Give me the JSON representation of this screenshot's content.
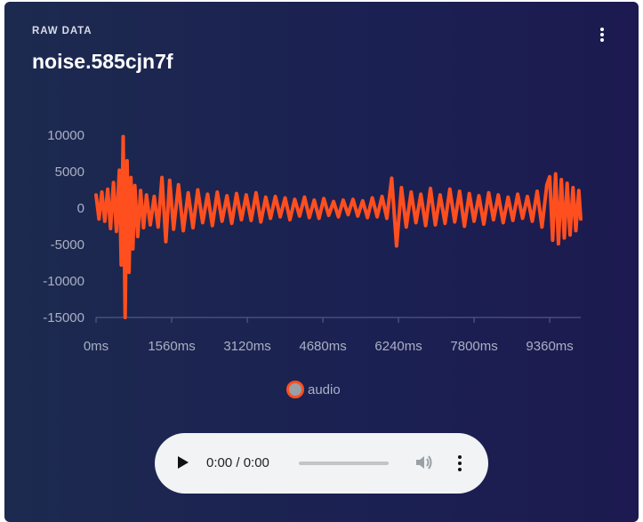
{
  "card": {
    "eyebrow": "RAW DATA",
    "title": "noise.585cjn7f"
  },
  "chart_data": {
    "type": "line",
    "title": "",
    "xlabel": "",
    "ylabel": "",
    "x_unit": "ms",
    "xlim": [
      0,
      10000
    ],
    "ylim": [
      -15000,
      10000
    ],
    "y_ticks": [
      "10000",
      "5000",
      "0",
      "-5000",
      "-10000",
      "-15000"
    ],
    "x_ticks": [
      "0ms",
      "1560ms",
      "3120ms",
      "4680ms",
      "6240ms",
      "7800ms",
      "9360ms"
    ],
    "legend_position": "bottom",
    "grid": false,
    "series": [
      {
        "name": "audio",
        "color": "#ff4f1f",
        "x": [
          0,
          60,
          120,
          180,
          240,
          300,
          360,
          420,
          480,
          520,
          560,
          600,
          640,
          680,
          720,
          760,
          800,
          860,
          920,
          980,
          1040,
          1120,
          1200,
          1280,
          1360,
          1440,
          1520,
          1600,
          1700,
          1800,
          1900,
          2000,
          2100,
          2200,
          2300,
          2400,
          2500,
          2600,
          2700,
          2800,
          2900,
          3000,
          3100,
          3200,
          3300,
          3400,
          3500,
          3600,
          3700,
          3800,
          3900,
          4000,
          4100,
          4200,
          4300,
          4400,
          4500,
          4600,
          4700,
          4800,
          4900,
          5000,
          5100,
          5200,
          5300,
          5400,
          5500,
          5600,
          5700,
          5800,
          5900,
          6000,
          6100,
          6200,
          6300,
          6400,
          6500,
          6600,
          6700,
          6800,
          6900,
          7000,
          7100,
          7200,
          7300,
          7400,
          7500,
          7600,
          7700,
          7800,
          7900,
          8000,
          8100,
          8200,
          8300,
          8400,
          8500,
          8600,
          8700,
          8800,
          8900,
          9000,
          9100,
          9200,
          9300,
          9360,
          9420,
          9480,
          9540,
          9600,
          9660,
          9720,
          9780,
          9840,
          9900,
          9960,
          10000
        ],
        "values": [
          1800,
          -1500,
          2200,
          -1800,
          2600,
          -2800,
          3500,
          -3200,
          5200,
          -7800,
          9800,
          -15000,
          6500,
          -8800,
          4200,
          -5600,
          3100,
          -3900,
          2400,
          -2700,
          1800,
          -2300,
          1600,
          -2600,
          4200,
          -4600,
          3800,
          -2900,
          3200,
          -3100,
          2100,
          -2700,
          2500,
          -2000,
          1900,
          -2400,
          2200,
          -1800,
          1700,
          -2100,
          2000,
          -1600,
          1800,
          -1700,
          2100,
          -1900,
          1500,
          -1400,
          1600,
          -1200,
          1400,
          -1600,
          1200,
          -1100,
          1500,
          -1300,
          1100,
          -1400,
          1300,
          -1000,
          900,
          -1200,
          1100,
          -900,
          1200,
          -1100,
          1000,
          -1300,
          1400,
          -1200,
          1600,
          -1400,
          4100,
          -5200,
          2800,
          -2600,
          2200,
          -2000,
          1900,
          -2400,
          2700,
          -2300,
          1800,
          -2100,
          2600,
          -1900,
          2300,
          -2500,
          2000,
          -1800,
          1700,
          -2200,
          2100,
          -1600,
          1800,
          -2000,
          1500,
          -1700,
          1900,
          -1400,
          1600,
          -1800,
          2300,
          -2600,
          3200,
          4300,
          -4400,
          4700,
          -4900,
          3900,
          -4100,
          3400,
          -3700,
          2800,
          -3100,
          2400,
          -1500
        ]
      }
    ]
  },
  "player": {
    "time": "0:00 / 0:00",
    "progress_fraction": 0
  }
}
